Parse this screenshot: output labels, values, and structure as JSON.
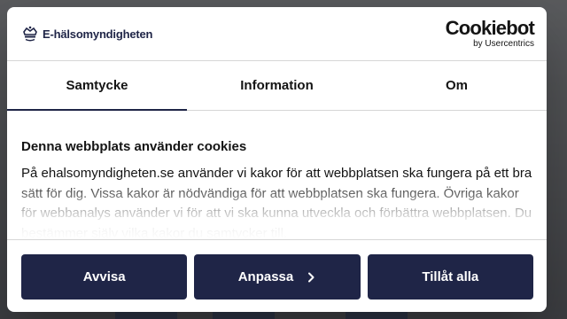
{
  "brand": {
    "name": "E-hälsomyndigheten",
    "color": "#1f2547"
  },
  "cookiebot": {
    "name": "Cookiebot",
    "sub": "by Usercentrics"
  },
  "tabs": [
    {
      "label": "Samtycke",
      "active": true
    },
    {
      "label": "Information",
      "active": false
    },
    {
      "label": "Om",
      "active": false
    }
  ],
  "content": {
    "title": "Denna webbplats använder cookies",
    "text": "På ehalsomyndigheten.se använder vi kakor för att webbplatsen ska fungera på ett bra sätt för dig. Vissa kakor är nödvändiga för att webbplatsen ska fungera. Övriga kakor för webbanalys använder vi för att vi ska kunna utveckla och förbättra webbplatsen. Du bestämmer själv vilka kakor du samtycker till."
  },
  "buttons": {
    "reject": "Avvisa",
    "customize": "Anpassa",
    "allow_all": "Tillåt alla"
  },
  "icons": {
    "brand": "crown-icon",
    "customize": "chevron-right-icon"
  }
}
